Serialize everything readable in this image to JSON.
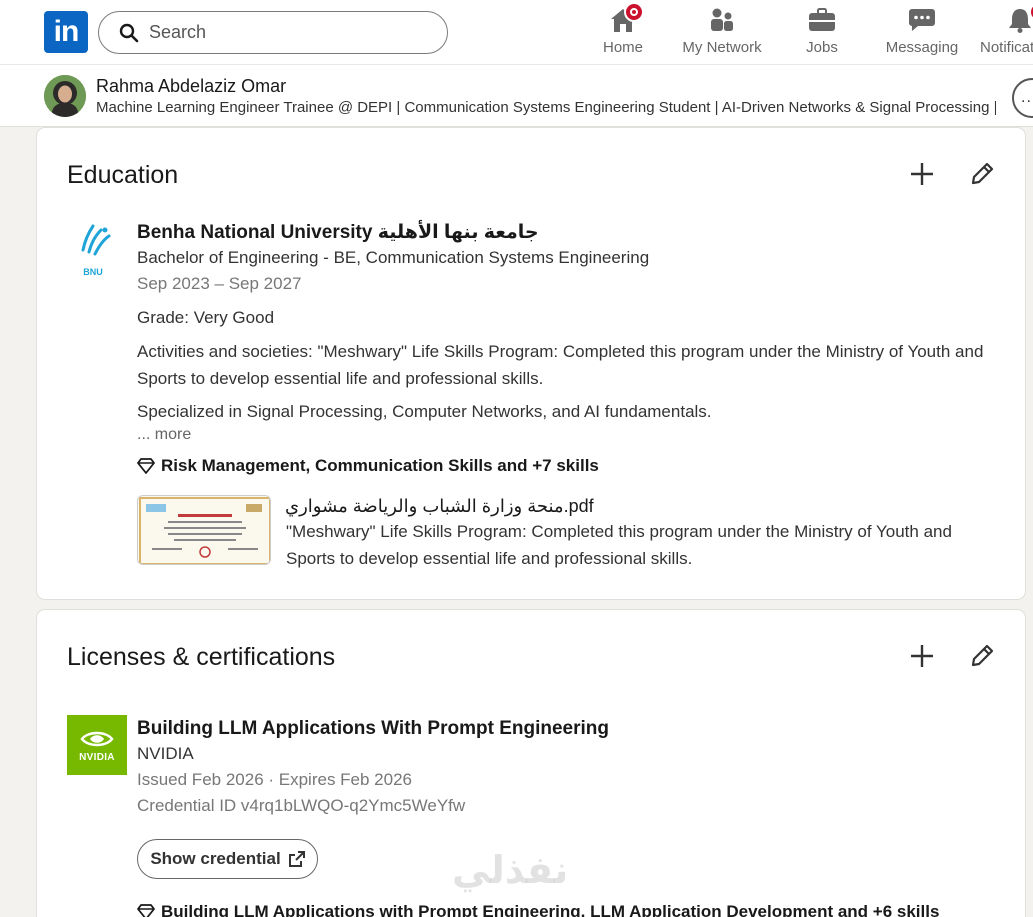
{
  "nav": {
    "logo_text": "in",
    "search_placeholder": "Search",
    "items": [
      {
        "label": "Home",
        "icon": "home-icon"
      },
      {
        "label": "My Network",
        "icon": "my-network-icon"
      },
      {
        "label": "Jobs",
        "icon": "jobs-icon"
      },
      {
        "label": "Messaging",
        "icon": "messaging-icon"
      },
      {
        "label": "Notifications",
        "icon": "notifications-icon"
      }
    ]
  },
  "profile": {
    "name": "Rahma Abdelaziz Omar",
    "headline": "Machine Learning Engineer Trainee @ DEPI | Communication Systems Engineering Student | AI-Driven Networks & Signal Processing | ...",
    "more_label": "..."
  },
  "education": {
    "title": "Education",
    "school": "Benha National University جامعة بنها الأهلية",
    "school_logo_text": "BNU",
    "degree": "Bachelor of Engineering - BE, Communication Systems Engineering",
    "dates": "Sep 2023 – Sep 2027",
    "grade": "Grade: Very Good",
    "activities": "Activities and societies: \"Meshwary\" Life Skills Program: Completed this program under the Ministry of Youth and Sports to develop essential life and professional skills.",
    "description": "Specialized in Signal Processing, Computer Networks, and AI fundamentals.",
    "more_label": "... more",
    "skills": "Risk Management, Communication Skills and +7 skills",
    "media_title": "منحة وزارة الشباب والرياضة مشواري.pdf",
    "media_description": "\"Meshwary\" Life Skills Program: Completed this program under the Ministry of Youth and Sports to develop essential life and professional skills."
  },
  "licenses": {
    "title": "Licenses & certifications",
    "cert_name": "Building LLM Applications With Prompt Engineering",
    "issuer": "NVIDIA",
    "issuer_logo_text": "NVIDIA",
    "issued": "Issued Feb 2026 · Expires Feb 2026",
    "credential_id": "Credential ID v4rq1bLWQO-q2Ymc5WeYfw",
    "show_credential_label": "Show credential",
    "skills": "Building LLM Applications with Prompt Engineering, LLM Application Development and +6 skills"
  },
  "watermark": "نفذلي",
  "colors": {
    "brand": "#0a66c2",
    "nvidia": "#76b900",
    "badge": "#cb112d"
  }
}
